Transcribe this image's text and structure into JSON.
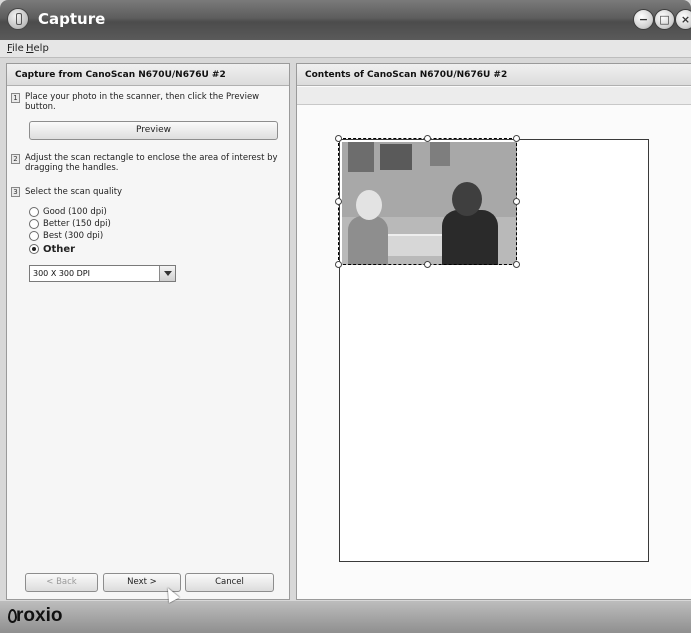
{
  "window": {
    "title": "Capture",
    "buttons": [
      "minimize",
      "maximize",
      "close"
    ]
  },
  "menu": {
    "items": [
      {
        "label": "File",
        "underline": "F",
        "rest": "ile"
      },
      {
        "label": "Help",
        "underline": "H",
        "rest": "elp"
      }
    ]
  },
  "left_panel": {
    "header": "Capture from CanoScan N670U/N676U #2",
    "steps": [
      {
        "num": "1",
        "text": "Place your photo in the scanner, then click the Preview button."
      },
      {
        "num": "2",
        "text": "Adjust the scan rectangle to enclose the area of interest by dragging the handles."
      },
      {
        "num": "3",
        "text": "Select the scan quality"
      }
    ],
    "preview_button": "Preview",
    "quality_options": [
      {
        "label": "Good (100 dpi)",
        "selected": false
      },
      {
        "label": "Better (150 dpi)",
        "selected": false
      },
      {
        "label": "Best (300 dpi)",
        "selected": false
      },
      {
        "label": "Other",
        "selected": true
      }
    ],
    "dpi_select": {
      "value": "300 X 300 DPI"
    },
    "nav": {
      "back": "< Back",
      "next": "Next >",
      "cancel": "Cancel"
    }
  },
  "right_panel": {
    "header": "Contents of CanoScan N670U/N676U #2"
  },
  "footer": {
    "logo": "roxio"
  }
}
